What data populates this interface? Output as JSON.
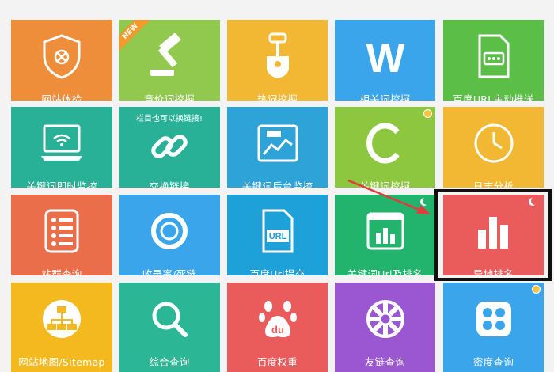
{
  "tiles": [
    {
      "label": "网站体检",
      "icon": "shield-bug-icon",
      "color": "#ee8d3a"
    },
    {
      "label": "竟价词挖掘",
      "icon": "gavel-icon",
      "color": "#90c94e",
      "badge": "NEW"
    },
    {
      "label": "热词挖掘",
      "icon": "shovel-icon",
      "color": "#f2b833"
    },
    {
      "label": "相关词挖掘",
      "icon": "w-letter-icon",
      "color": "#3aa5ea"
    },
    {
      "label": "百度URL主动推送",
      "icon": "document-push-icon",
      "color": "#5bbf47"
    },
    {
      "label": "关键词即时监控",
      "icon": "monitor-icon",
      "color": "#29b198"
    },
    {
      "label": "交换链接",
      "icon": "chain-link-icon",
      "color": "#29b198",
      "note": "栏目也可以换链接!"
    },
    {
      "label": "关键词后台监控",
      "icon": "chart-screen-icon",
      "color": "#2ea3d8"
    },
    {
      "label": "关键词挖掘",
      "icon": "c-letter-icon",
      "color": "#8dc63f"
    },
    {
      "label": "日志分析",
      "icon": "clock-icon",
      "color": "#f2b833"
    },
    {
      "label": "站群查询",
      "icon": "list-icon",
      "color": "#ea6e4a"
    },
    {
      "label": "收录率/死链",
      "icon": "ring-icon",
      "color": "#3aa5ea"
    },
    {
      "label": "百度Url提交",
      "icon": "url-file-icon",
      "color": "#1ea0d8"
    },
    {
      "label": "关键词Url及排名",
      "icon": "bar-chart-window-icon",
      "color": "#22b46d"
    },
    {
      "label": "异地排名",
      "icon": "bar-chart-icon",
      "color": "#ea5b5b"
    },
    {
      "label": "网站地图/Sitemap",
      "icon": "sitemap-icon",
      "color": "#f4b91f"
    },
    {
      "label": "综合查询",
      "icon": "magnifier-icon",
      "color": "#2bb796"
    },
    {
      "label": "百度权重",
      "icon": "paw-icon",
      "color": "#ea5b5b"
    },
    {
      "label": "友链查询",
      "icon": "wheel-icon",
      "color": "#9b56d2"
    },
    {
      "label": "密度查询",
      "icon": "grid-dots-icon",
      "color": "#3aa5ea"
    }
  ]
}
